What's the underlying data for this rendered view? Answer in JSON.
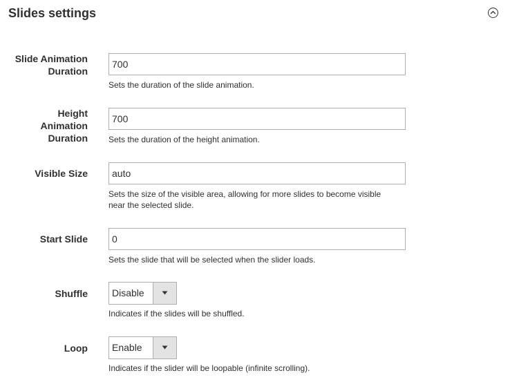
{
  "section": {
    "title": "Slides settings",
    "collapse_icon": "chevron-up-circle-icon"
  },
  "fields": {
    "slide_animation_duration": {
      "label": "Slide Animation Duration",
      "value": "700",
      "note": "Sets the duration of the slide animation."
    },
    "height_animation_duration": {
      "label": "Height Animation Duration",
      "value": "700",
      "note": "Sets the duration of the height animation."
    },
    "visible_size": {
      "label": "Visible Size",
      "value": "auto",
      "note": "Sets the size of the visible area, allowing for more slides to become visible near the selected slide."
    },
    "start_slide": {
      "label": "Start Slide",
      "value": "0",
      "note": "Sets the slide that will be selected when the slider loads."
    },
    "shuffle": {
      "label": "Shuffle",
      "value": "Disable",
      "note": "Indicates if the slides will be shuffled."
    },
    "loop": {
      "label": "Loop",
      "value": "Enable",
      "note": "Indicates if the slider will be loopable (infinite scrolling)."
    }
  }
}
